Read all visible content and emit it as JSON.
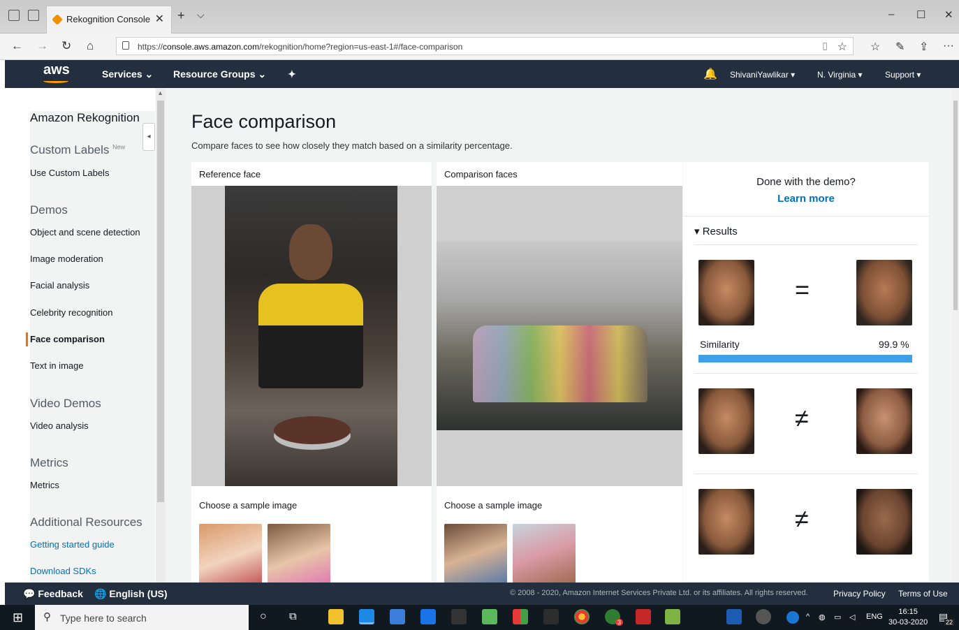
{
  "browser": {
    "tab_title": "Rekognition Console",
    "tab_close": "✕",
    "new_tab": "+",
    "tab_menu": "⌵",
    "url_prefix": "https://",
    "url_host": "console.aws.amazon.com",
    "url_path": "/rekognition/home?region=us-east-1#/face-comparison",
    "win_min": "–",
    "win_max": "☐",
    "win_close": "✕",
    "back": "←",
    "forward": "→",
    "refresh": "↻",
    "home": "⌂",
    "star": "☆",
    "favorites": "☆",
    "pen": "✎",
    "share": "⇪",
    "more": "···"
  },
  "aws_nav": {
    "logo": "aws",
    "services": "Services ⌄",
    "resource_groups": "Resource Groups ⌄",
    "pin": "✦",
    "bell": "🔔",
    "user": "ShivaniYawlikar ▾",
    "region": "N. Virginia ▾",
    "support": "Support ▾"
  },
  "sidebar": {
    "service_title": "Amazon Rekognition",
    "custom_labels": "Custom Labels",
    "new_badge": "New",
    "use_custom_labels": "Use Custom Labels",
    "demos": "Demos",
    "demo_items": [
      "Object and scene detection",
      "Image moderation",
      "Facial analysis",
      "Celebrity recognition",
      "Face comparison",
      "Text in image"
    ],
    "video_demos": "Video Demos",
    "video_analysis": "Video analysis",
    "metrics_header": "Metrics",
    "metrics_link": "Metrics",
    "additional_resources": "Additional Resources",
    "getting_started": "Getting started guide",
    "download_sdks": "Download SDKs",
    "collapse_icon": "◂"
  },
  "main": {
    "title": "Face comparison",
    "subtitle": "Compare faces to see how closely they match based on a similarity percentage.",
    "reference_label": "Reference face",
    "comparison_label": "Comparison faces",
    "choose_sample_left": "Choose a sample image",
    "choose_sample_right": "Choose a sample image"
  },
  "results_panel": {
    "done_text": "Done with the demo?",
    "learn_more": "Learn more",
    "results_label": "▾  Results",
    "match_symbol": "=",
    "nomatch_symbol": "≠",
    "similarity_label": "Similarity",
    "similarity_value": "99.9 %",
    "similarity_fraction": 0.999
  },
  "footer": {
    "feedback": "Feedback",
    "language": "English (US)",
    "copyright": "© 2008 - 2020, Amazon Internet Services Private Ltd. or its affiliates. All rights reserved.",
    "privacy": "Privacy Policy",
    "terms": "Terms of Use"
  },
  "taskbar": {
    "search_placeholder": "Type here to search",
    "language": "ENG",
    "time": "16:15",
    "date": "30-03-2020",
    "notif_count": "22",
    "badge_count": "3"
  },
  "colors": {
    "aws_dark": "#232f3e",
    "accent_orange": "#ec7211",
    "link_blue": "#0073bb",
    "similarity_bar": "#3f9fe8"
  }
}
